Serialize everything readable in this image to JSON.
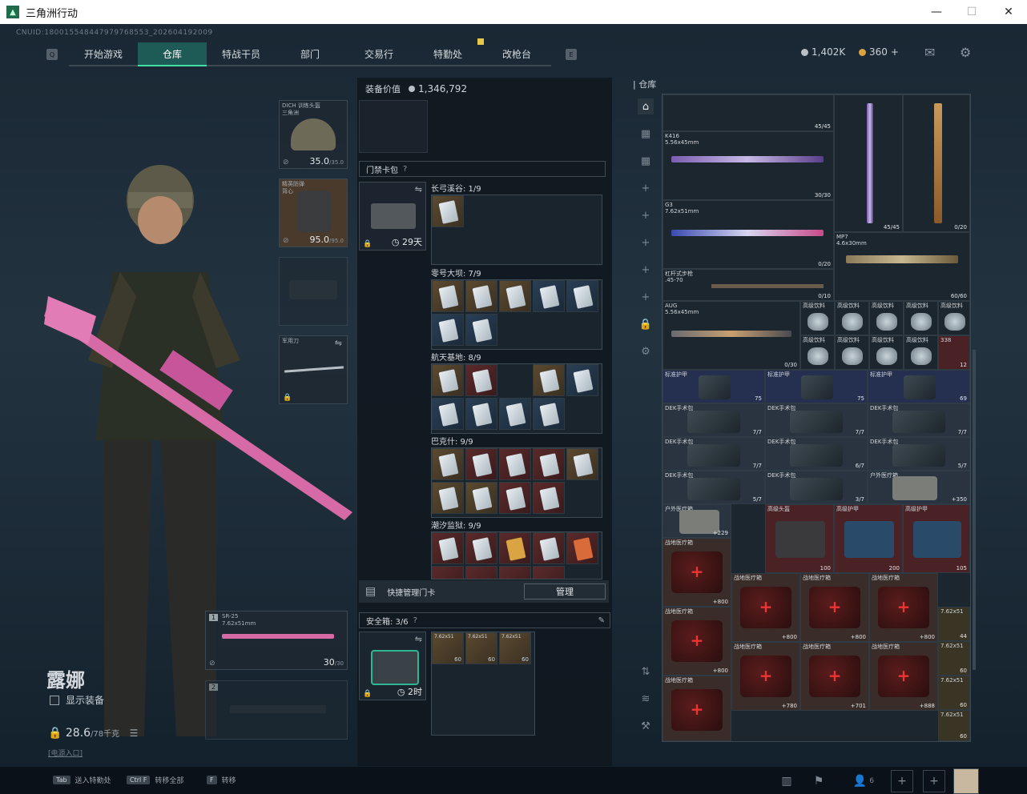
{
  "window": {
    "title": "三角洲行动",
    "controls": [
      "—",
      "☐",
      "✕"
    ]
  },
  "header": {
    "uid": "CNUID:180015548447979768553_202604192009",
    "tabs": [
      {
        "label": "开始游戏",
        "active": false
      },
      {
        "label": "仓库",
        "active": true
      },
      {
        "label": "特战干员",
        "active": false
      },
      {
        "label": "部门",
        "active": false
      },
      {
        "label": "交易行",
        "active": false
      },
      {
        "label": "特勤处",
        "active": false
      },
      {
        "label": "改枪台",
        "active": false
      }
    ],
    "prev_key": "Q",
    "next_key": "E",
    "currency_silver": "1,402K",
    "currency_gold": "360",
    "currency_plus": "+",
    "accent": "#42e0a6"
  },
  "character": {
    "name": "露娜",
    "show_equipment": "显示装备",
    "weight": "28.6",
    "weight_max": "/78千克",
    "weight_link": "[电源入口]"
  },
  "equip_slots": {
    "helmet": {
      "label": "DICH 训练头盔\n三角洲",
      "value": "35.0",
      "max": "/35.0"
    },
    "armor": {
      "label": "精英防弹\n背心",
      "value": "95.0",
      "max": "/95.0"
    },
    "melee": {
      "label": "军用刀"
    },
    "primary": {
      "index": "1",
      "name": "SR-25",
      "caliber": "7.62x51mm",
      "ammo": "30",
      "ammo_max": "/30"
    },
    "secondary": {
      "index": "2"
    }
  },
  "middle": {
    "equip_value_label": "装备价值",
    "equip_value": "1,346,792",
    "keycard_header": "门禁卡包",
    "keycard_days": "29天",
    "maps": [
      {
        "name": "长弓溪谷: 1/9"
      },
      {
        "name": "零号大坝: 7/9"
      },
      {
        "name": "航天基地: 8/9"
      },
      {
        "name": "巴克什: 9/9"
      },
      {
        "name": "潮汐监狱: 9/9"
      }
    ],
    "quick_manage": "快捷管理门卡",
    "manage_btn": "管理",
    "safebox_label": "安全箱: 3/6",
    "safebox_time": "2时",
    "safebox_items": [
      {
        "label": "7.62x51",
        "count": "60"
      },
      {
        "label": "7.62x51",
        "count": "60"
      },
      {
        "label": "7.62x51",
        "count": "60"
      }
    ]
  },
  "warehouse": {
    "title": "仓库",
    "guns": [
      {
        "name": "K416",
        "cal": "5.56x45mm",
        "ammo": "30/30"
      },
      {
        "name": "G3",
        "cal": "7.62x51mm",
        "ammo": "0/20"
      },
      {
        "name": "MP7",
        "cal": "4.6x30mm",
        "ammo": "60/60"
      },
      {
        "name": "杠杆式步枪",
        "cal": ".45-70",
        "ammo": "0/10"
      },
      {
        "name": "AUG",
        "cal": "5.56x45mm",
        "ammo": "0/30"
      }
    ],
    "mag_count": "45/45",
    "mag_count2": "45/45",
    "vert_gun_ammo": "0/20",
    "drink_label": "高级饮料",
    "drink_count": "12",
    "drink_tag": "338",
    "armor_label": "标准护甲",
    "armor_vals": [
      "75",
      "75",
      "69"
    ],
    "surgery_label": "DEK手术包",
    "surgery_counts": [
      "7/7",
      "7/7",
      "7/7",
      "7/7",
      "6/7",
      "5/7",
      "5/7",
      "3/7"
    ],
    "outdoor_label": "户外医疗箱",
    "outdoor_vals": [
      "350",
      "229"
    ],
    "helm_label": "高级头盔",
    "heavy_armor_label": "高级护甲",
    "heavy_vals": [
      "100",
      "200",
      "105"
    ],
    "field_label": "战地医疗箱",
    "field_vals": [
      "800",
      "800",
      "800",
      "800",
      "800",
      "780",
      "701",
      "888"
    ],
    "ammo_label": "7.62x51",
    "ammo_counts": [
      "44",
      "60",
      "60",
      "60"
    ]
  },
  "bottom": {
    "hints": [
      {
        "key": "Tab",
        "label": "送入特勤处"
      },
      {
        "key": "Ctrl F",
        "label": "转移全部"
      },
      {
        "key": "F",
        "label": "转移"
      }
    ],
    "squad_count": "6"
  }
}
